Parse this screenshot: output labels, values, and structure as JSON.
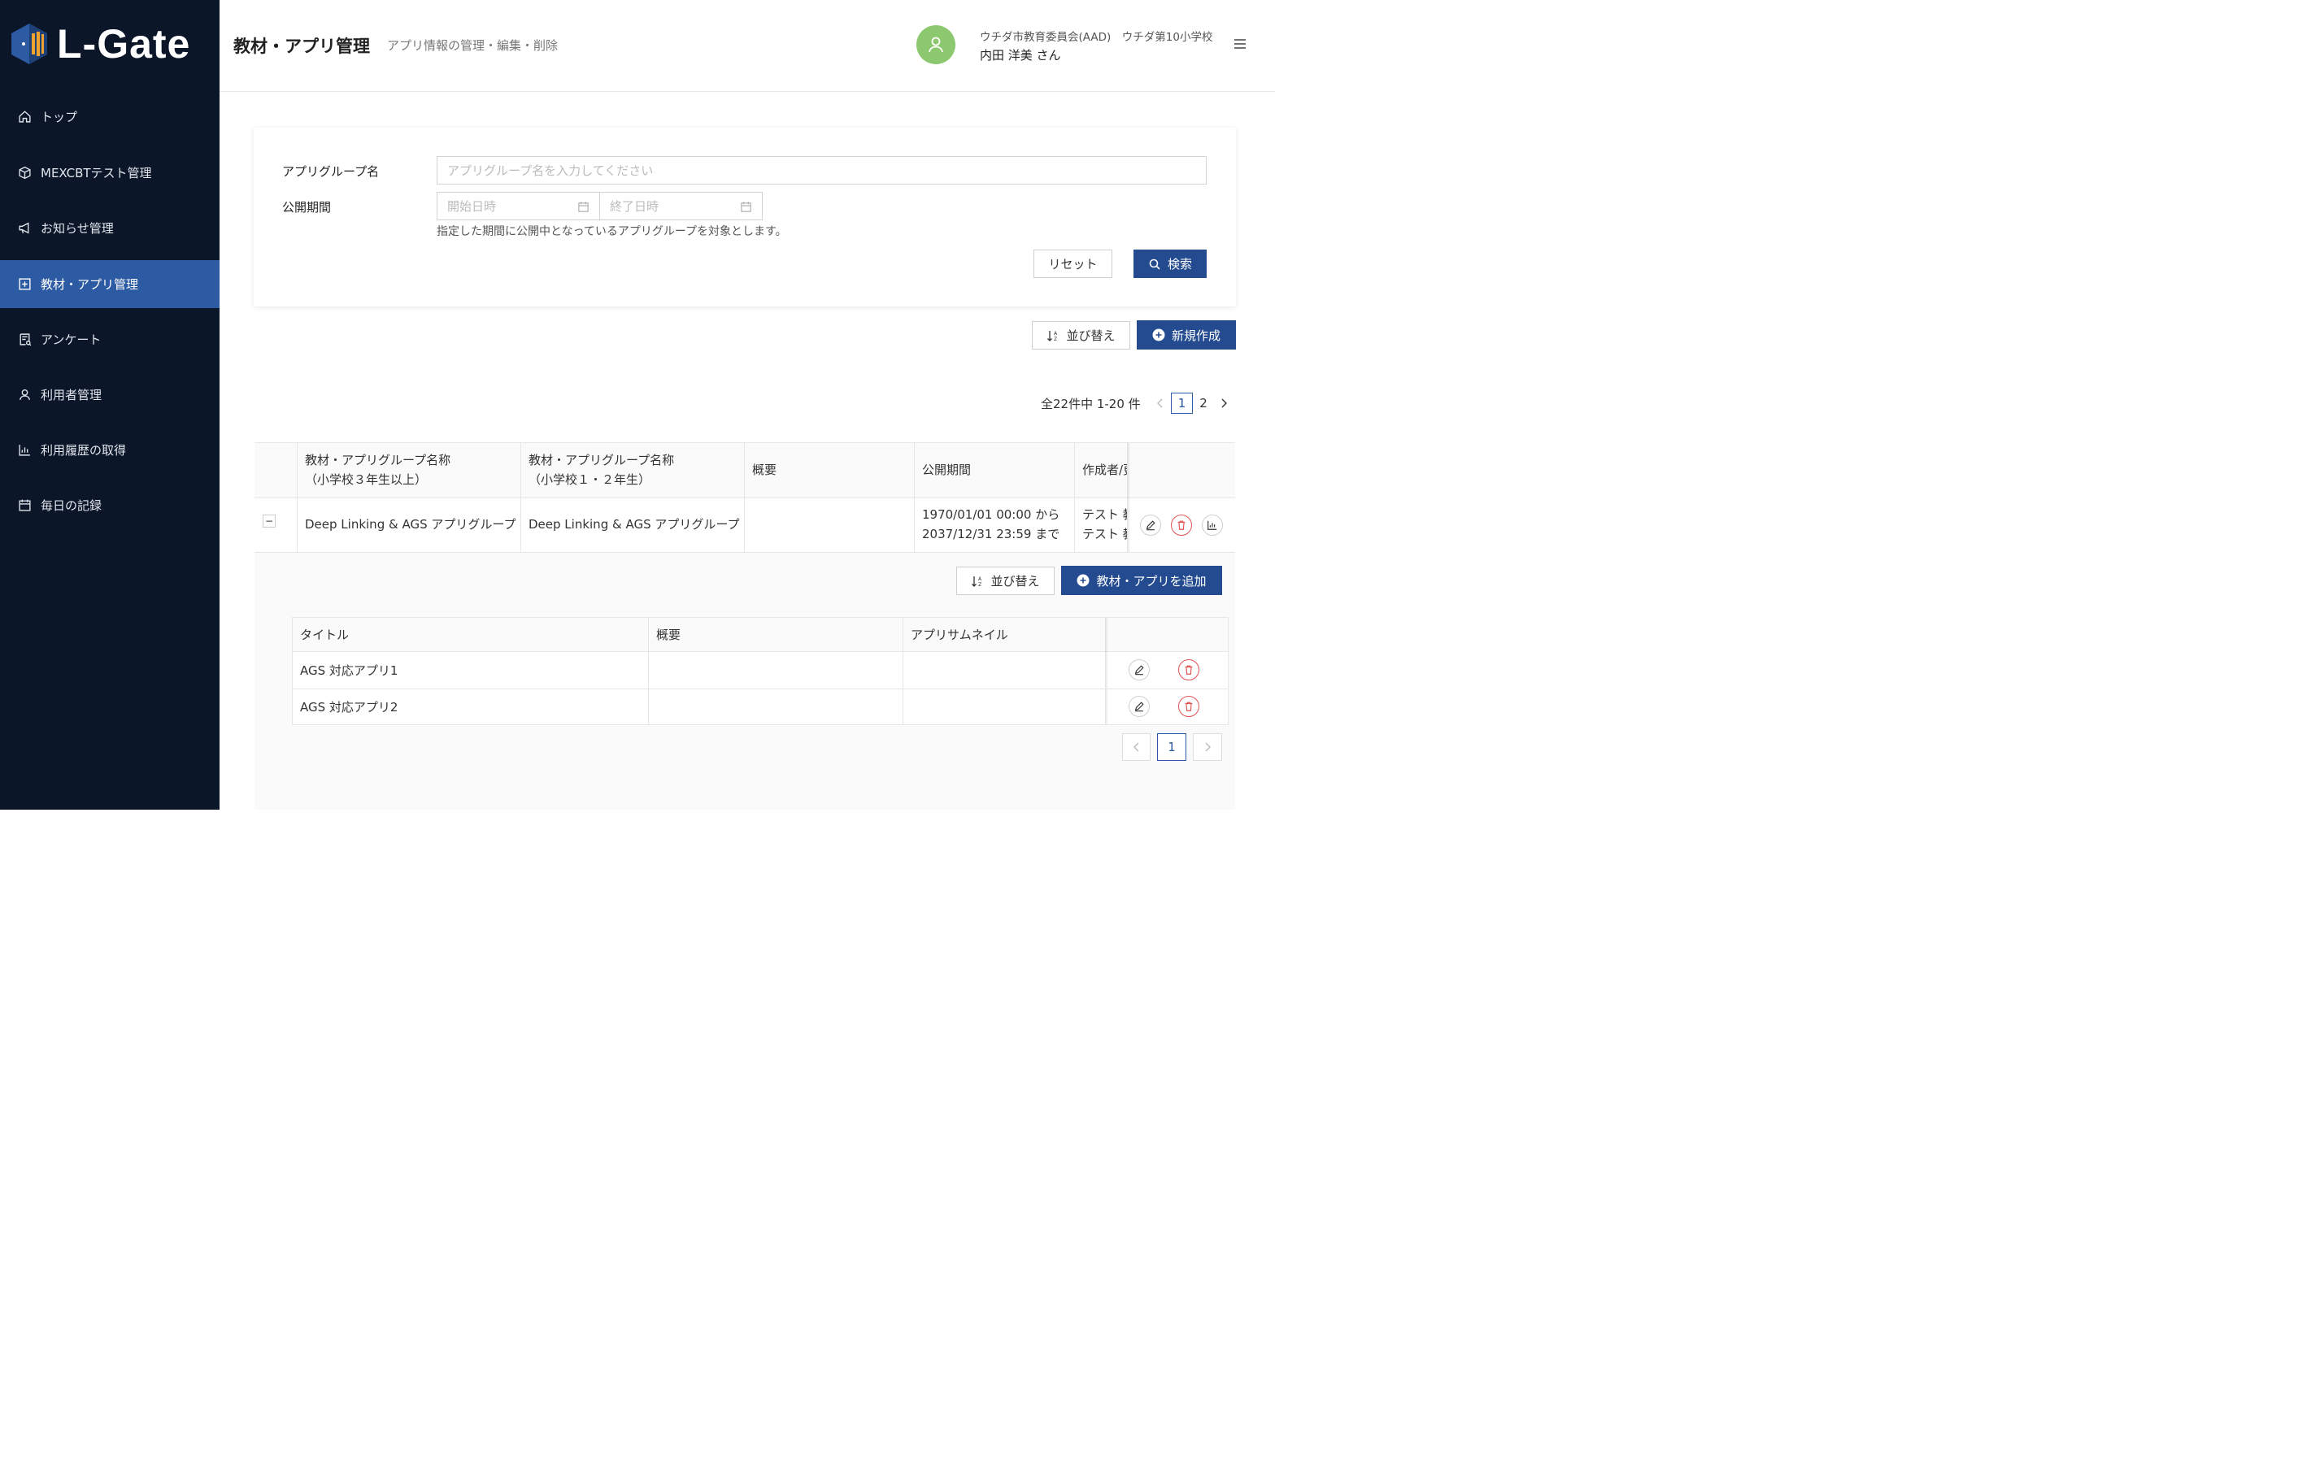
{
  "app": {
    "logo_text": "L-Gate"
  },
  "sidebar": {
    "items": [
      {
        "label": "トップ",
        "icon": "home-icon"
      },
      {
        "label": "MEXCBTテスト管理",
        "icon": "cube-icon"
      },
      {
        "label": "お知らせ管理",
        "icon": "megaphone-icon"
      },
      {
        "label": "教材・アプリ管理",
        "icon": "plus-square-icon",
        "active": true
      },
      {
        "label": "アンケート",
        "icon": "survey-icon"
      },
      {
        "label": "利用者管理",
        "icon": "user-icon"
      },
      {
        "label": "利用履歴の取得",
        "icon": "bar-chart-icon"
      },
      {
        "label": "毎日の記録",
        "icon": "calendar-icon"
      }
    ]
  },
  "header": {
    "title": "教材・アプリ管理",
    "subtitle": "アプリ情報の管理・編集・削除",
    "org": "ウチダ市教育委員会(AAD)　ウチダ第10小学校",
    "user": "内田 洋美 さん"
  },
  "search": {
    "group_name_label": "アプリグループ名",
    "group_name_placeholder": "アプリグループ名を入力してください",
    "period_label": "公開期間",
    "start_placeholder": "開始日時",
    "end_placeholder": "終了日時",
    "hint": "指定した期間に公開中となっているアプリグループを対象とします。",
    "reset_label": "リセット",
    "search_label": "検索"
  },
  "actions": {
    "sort_label": "並び替え",
    "create_label": "新規作成"
  },
  "pagination": {
    "summary": "全22件中 1-20 件",
    "pages": [
      "1",
      "2"
    ],
    "current": "1"
  },
  "table": {
    "headers": {
      "name_upper_1": "教材・アプリグループ名称",
      "name_upper_2": "（小学校３年生以上）",
      "name_lower_1": "教材・アプリグループ名称",
      "name_lower_2": "（小学校１・２年生）",
      "summary": "概要",
      "period": "公開期間",
      "author": "作成者/更"
    },
    "rows": [
      {
        "expand_symbol": "−",
        "name_upper": "Deep Linking & AGS アプリグループ",
        "name_lower": "Deep Linking & AGS アプリグループ",
        "summary": "",
        "period_from": "1970/01/01 00:00 から",
        "period_to": "2037/12/31 23:59 まで",
        "author_1": "テスト 教",
        "author_2": "テスト 教"
      }
    ]
  },
  "subtable": {
    "sort_label": "並び替え",
    "add_label": "教材・アプリを追加",
    "headers": {
      "title": "タイトル",
      "summary": "概要",
      "thumbnail": "アプリサムネイル"
    },
    "rows": [
      {
        "title": "AGS 対応アプリ1",
        "summary": "",
        "thumbnail": ""
      },
      {
        "title": "AGS 対応アプリ2",
        "summary": "",
        "thumbnail": ""
      }
    ],
    "pagination": {
      "current": "1"
    }
  },
  "colors": {
    "sidebar_bg": "#0b1629",
    "active_nav": "#2d5ba3",
    "primary": "#244b8f",
    "danger": "#e05353",
    "avatar": "#8cc86e"
  }
}
